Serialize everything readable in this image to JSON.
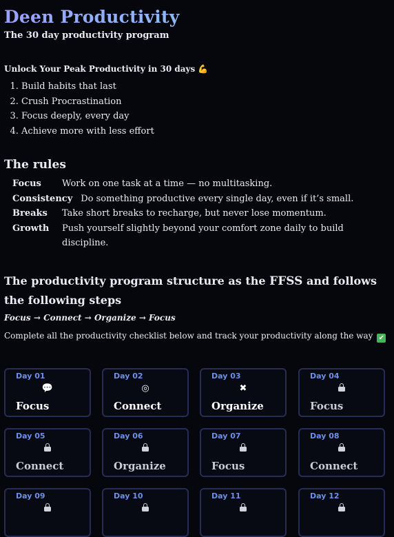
{
  "brand": "Deen Productivity",
  "tagline": "The 30 day productivity program",
  "unlock": "Unlock Your Peak Productivity in 30 days 💪",
  "goals": [
    "Build habits that last",
    "Crush Procrastination",
    "Focus deeply, every day",
    "Achieve more with less effort"
  ],
  "rules_title": "The rules",
  "rules": [
    {
      "term": "Focus",
      "desc": "Work on one task at a time — no multitasking."
    },
    {
      "term": "Consistency",
      "desc": "Do something productive every single day, even if it’s small."
    },
    {
      "term": "Breaks",
      "desc": "Take short breaks to recharge, but never lose momentum."
    },
    {
      "term": "Growth",
      "desc": "Push yourself slightly beyond your comfort zone daily to build discipline."
    }
  ],
  "structure": {
    "before": "The productivity program structure as the ",
    "ffss": "FFSS",
    "after": " and follows the following steps"
  },
  "steps": "Focus → Connect → Organize → Focus",
  "complete": "Complete all the productivity checklist below and track your productivity along the way",
  "days": [
    {
      "day": "Day 01",
      "title": "Focus",
      "icon": "chat-bubbles-icon",
      "glyph": "💬",
      "locked": false
    },
    {
      "day": "Day 02",
      "title": "Connect",
      "icon": "target-icon",
      "glyph": "◎",
      "locked": false
    },
    {
      "day": "Day 03",
      "title": "Organize",
      "icon": "tools-icon",
      "glyph": "✖",
      "locked": false
    },
    {
      "day": "Day 04",
      "title": "Focus",
      "icon": "lock-icon",
      "locked": true
    },
    {
      "day": "Day 05",
      "title": "Connect",
      "icon": "lock-icon",
      "locked": true
    },
    {
      "day": "Day 06",
      "title": "Organize",
      "icon": "lock-icon",
      "locked": true
    },
    {
      "day": "Day 07",
      "title": "Focus",
      "icon": "lock-icon",
      "locked": true
    },
    {
      "day": "Day 08",
      "title": "Connect",
      "icon": "lock-icon",
      "locked": true
    },
    {
      "day": "Day 09",
      "title": "",
      "icon": "lock-icon",
      "locked": true
    },
    {
      "day": "Day 10",
      "title": "",
      "icon": "lock-icon",
      "locked": true
    },
    {
      "day": "Day 11",
      "title": "",
      "icon": "lock-icon",
      "locked": true
    },
    {
      "day": "Day 12",
      "title": "",
      "icon": "lock-icon",
      "locked": true
    }
  ],
  "colors": {
    "background": "#05070c",
    "card_border": "#272c56",
    "day_label": "#6d8fe8",
    "brand_gradient_start": "#9aa0ff",
    "brand_gradient_end": "#7fd8e6",
    "check": "#47b35a"
  }
}
